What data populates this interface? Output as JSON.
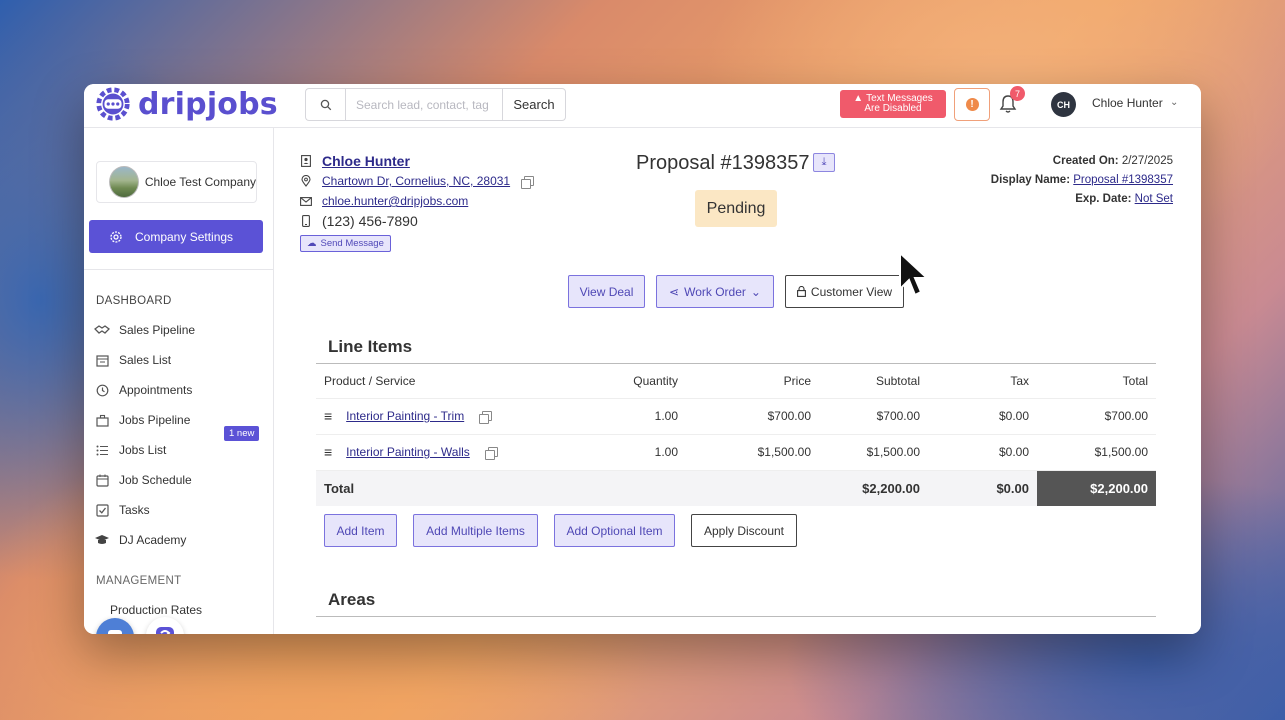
{
  "brand": {
    "name": "dripjobs",
    "color": "#5a4fcf"
  },
  "topbar": {
    "search_placeholder": "Search lead, contact, tag",
    "search_button": "Search",
    "sms_warning_line1": "Text Messages",
    "sms_warning_line2": "Are Disabled",
    "notification_count": "7",
    "user_initials": "CH",
    "user_name": "Chloe Hunter"
  },
  "sidebar": {
    "company_name": "Chloe Test Company",
    "settings_label": "Company Settings",
    "section_label": "DASHBOARD",
    "items": [
      {
        "label": "Sales Pipeline",
        "icon": "handshake-icon"
      },
      {
        "label": "Sales List",
        "icon": "calendar-list-icon"
      },
      {
        "label": "Appointments",
        "icon": "clock-icon",
        "badge": "1 new"
      },
      {
        "label": "Jobs Pipeline",
        "icon": "briefcase-icon"
      },
      {
        "label": "Jobs List",
        "icon": "list-icon"
      },
      {
        "label": "Job Schedule",
        "icon": "calendar-icon"
      },
      {
        "label": "Tasks",
        "icon": "checkbox-icon"
      },
      {
        "label": "DJ Academy",
        "icon": "graduation-cap-icon"
      }
    ],
    "partial_section_label": "MANAGEMENT",
    "partial_item_label": "Production Rates"
  },
  "contact": {
    "name": "Chloe Hunter",
    "address": "Chartown Dr, Cornelius, NC, 28031",
    "email": "chloe.hunter@dripjobs.com",
    "phone": "(123) 456-7890",
    "send_message": "Send Message"
  },
  "proposal": {
    "title": "Proposal #1398357",
    "status": "Pending",
    "created_label": "Created On:",
    "created_value": "2/27/2025",
    "display_label": "Display Name:",
    "display_value": "Proposal #1398357",
    "exp_label": "Exp. Date:",
    "exp_value": "Not Set"
  },
  "actions": {
    "view_deal": "View Deal",
    "work_order": "Work Order",
    "customer_view": "Customer View"
  },
  "line_items": {
    "title": "Line Items",
    "columns": [
      "Product / Service",
      "Quantity",
      "Price",
      "Subtotal",
      "Tax",
      "Total"
    ],
    "rows": [
      {
        "name": "Interior Painting - Trim",
        "quantity": "1.00",
        "price": "$700.00",
        "subtotal": "$700.00",
        "tax": "$0.00",
        "total": "$700.00"
      },
      {
        "name": "Interior Painting - Walls",
        "quantity": "1.00",
        "price": "$1,500.00",
        "subtotal": "$1,500.00",
        "tax": "$0.00",
        "total": "$1,500.00"
      }
    ],
    "total_label": "Total",
    "total_subtotal": "$2,200.00",
    "total_tax": "$0.00",
    "total_grand": "$2,200.00"
  },
  "item_buttons": {
    "add_item": "Add Item",
    "add_multiple": "Add Multiple Items",
    "add_optional": "Add Optional Item",
    "apply_discount": "Apply Discount"
  },
  "areas": {
    "title": "Areas"
  },
  "colors": {
    "accent": "#5b52d6",
    "sms_warning": "#f05a6b",
    "status_pending": "#fbe7c4",
    "grand_total_bg": "#555555"
  }
}
